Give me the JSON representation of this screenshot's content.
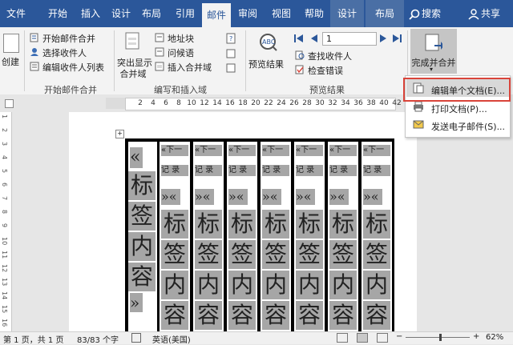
{
  "tabs": [
    {
      "label": "文件"
    },
    {
      "label": "开始"
    },
    {
      "label": "插入"
    },
    {
      "label": "设计"
    },
    {
      "label": "布局"
    },
    {
      "label": "引用"
    },
    {
      "label": "邮件"
    },
    {
      "label": "审阅"
    },
    {
      "label": "视图"
    },
    {
      "label": "帮助"
    },
    {
      "label": "设计"
    },
    {
      "label": "布局"
    }
  ],
  "search_label": "搜索",
  "share_label": "共享",
  "ribbon": {
    "create": "创建",
    "start_merge": "开始邮件合并",
    "select_recipients": "选择收件人",
    "edit_recipients": "编辑收件人列表",
    "group_start": "开始邮件合并",
    "highlight_line1": "突出显示",
    "highlight_line2": "合并域",
    "address_block": "地址块",
    "greeting_line": "问候语",
    "insert_merge_field": "插入合并域",
    "group_write": "编写和插入域",
    "preview_results": "预览结果",
    "record_number": "1",
    "find_recipient": "查找收件人",
    "check_errors": "检查错误",
    "group_preview": "预览结果",
    "finish_line1": "完成并合并",
    "accent": "#2b579a"
  },
  "dropdown": {
    "items": [
      {
        "label": "编辑单个文档(E)..."
      },
      {
        "label": "打印文档(P)..."
      },
      {
        "label": "发送电子邮件(S)..."
      }
    ]
  },
  "ruler_ticks": [
    "2",
    "4",
    "6",
    "8",
    "10",
    "12",
    "14",
    "16",
    "18",
    "20",
    "22",
    "24",
    "26",
    "28",
    "30",
    "32",
    "34",
    "36",
    "38",
    "40",
    "42"
  ],
  "vruler_ticks": [
    "1",
    "2",
    "3",
    "4",
    "5",
    "6",
    "7",
    "8",
    "9",
    "10",
    "11",
    "12",
    "13",
    "14",
    "15",
    "16"
  ],
  "doc": {
    "first_open": "«",
    "first_chars": [
      "标",
      "签",
      "内",
      "容"
    ],
    "first_close": "»",
    "next_record": "«下一",
    "next_record2": "记 录",
    "field_open": "»«",
    "chars": [
      "标",
      "签",
      "内",
      "容"
    ]
  },
  "status": {
    "page": "第 1 页，共 1 页",
    "words": "83/83 个字",
    "language": "英语(美国)",
    "zoom": "62%"
  }
}
